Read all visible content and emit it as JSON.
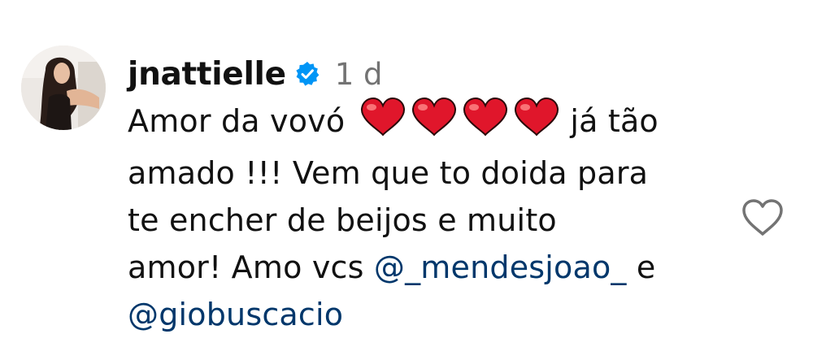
{
  "comment": {
    "username": "jnattielle",
    "verified": true,
    "time": "1 d",
    "text": {
      "line1_start": "Amor da vovó",
      "hearts": [
        "❤️",
        "❤️",
        "❤️",
        "❤️"
      ],
      "line1_end": "já tão",
      "line2": "amado !!! Vem que to doida para",
      "line3": "te encher de beijos e muito",
      "line4_start": "amor! Amo vcs ",
      "mention1": "@_mendesjoao_",
      "line4_end": " e",
      "mention2": "@giobuscacio"
    }
  },
  "colors": {
    "text": "#111111",
    "secondary": "#737373",
    "mention": "#00376b",
    "verified_badge": "#0095f6",
    "heart": "#e0162b",
    "like_outline": "#737373"
  },
  "icons": {
    "verified": "verified-badge-icon",
    "heart_emoji": "red-heart-emoji-icon",
    "like": "heart-outline-icon"
  }
}
